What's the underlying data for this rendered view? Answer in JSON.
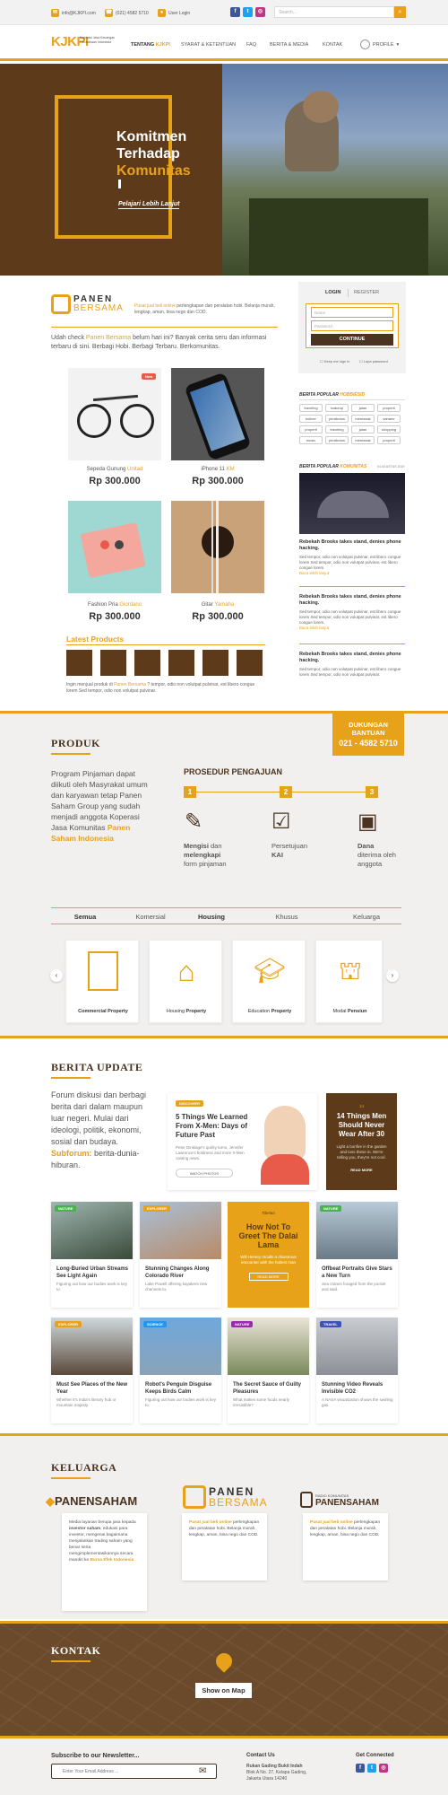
{
  "topbar": {
    "email": "info@KJKPI.com",
    "phone": "(021) 4582 5710",
    "login": "User Login",
    "search_placeholder": "Search..."
  },
  "brand": {
    "logo": "KJKPI",
    "tagline": "Koperasi Jasa Keuangan Perusahaan Indonesia"
  },
  "nav": {
    "items": [
      {
        "pre": "TENTANG ",
        "em": "KJKPI"
      },
      {
        "pre": "SYARAT & KETENTUAN",
        "em": ""
      },
      {
        "pre": "FAQ",
        "em": ""
      },
      {
        "pre": "BERITA & MEDIA",
        "em": ""
      },
      {
        "pre": "KONTAK",
        "em": ""
      }
    ],
    "profile": "PROFILE"
  },
  "hero": {
    "line1": "Komitmen",
    "line2": "Terhadap",
    "line3": "Komunitas",
    "cta": "Pelajari Lebih Lanjut"
  },
  "panen": {
    "logo_top": "PANEN",
    "logo_bottom": "BERSAMA",
    "tagline_em": "Pusat jual beli online",
    "tagline": " perlengkapan dan peralatan hobi. Belanja murah, lengkap, aman, bisa nego dan COD.",
    "intro_pre": "Udah check ",
    "intro_em": "Panen Bersama",
    "intro_post": " belum hari ini? Banyak cerita seru dan informasi terbaru di sini. Berbagi Hobi. Berbagi Terbaru. Berkomunitas.",
    "products": [
      {
        "name": "Sepeda Gunung ",
        "em": "Unitad",
        "price": "Rp 300.000",
        "badge": "New"
      },
      {
        "name": "iPhone 11 ",
        "em": "KM",
        "price": "Rp 300.000",
        "badge": ""
      },
      {
        "name": "Fashion Pria ",
        "em": "Giordano",
        "price": "Rp 300.000",
        "badge": ""
      },
      {
        "name": "Gitar ",
        "em": "Yamaha",
        "price": "Rp 300.000",
        "badge": ""
      }
    ],
    "latest_title": "Latest Products",
    "latest_text_pre": "Ingin menjual produk di ",
    "latest_text_em": "Panen Bersama",
    "latest_text_post": " ? tempor, odio non volutpat pulvinar, est libero congue lorem Sed tempor, odio non volutpat pulvinar."
  },
  "login": {
    "tab_login": "LOGIN",
    "tab_register": "REGISTER",
    "name_ph": "Name",
    "pass_ph": "Password",
    "button": "CONTINUE",
    "keep": "Keep me sign in",
    "forgot": "Lupa password"
  },
  "sidebar": {
    "popular_title": "BERITA POPULAR",
    "popular_em": "HOBBIESID",
    "tags": [
      "traveling",
      "makeup",
      "jalan",
      "properti",
      "kuliner",
      "perabotan",
      "memasak",
      "sahamr",
      "properti",
      "traveling",
      "jalan",
      "shopping",
      "music",
      "perabotan",
      "memasak",
      "properti"
    ],
    "popular2_title": "BERITA POPULAR",
    "popular2_em": "KOMUNITAS",
    "date": "04 AGUSTUS 2019",
    "news": [
      {
        "title": "Rebekah Brooks takes stand, denies phone hacking.",
        "text": "Sed tempor, odio non volutpat pulvinar, est libero congue lorem Sed tempor, odio non volutpat pulvinar, est libero congue lorem.",
        "more": "Baca lebih lanjut"
      },
      {
        "title": "Rebekah Brooks takes stand, denies phone hacking.",
        "text": "Sed tempor, odio non volutpat pulvinar, est libero congue lorem Sed tempor, odio non volutpat pulvinar, est libero congue lorem.",
        "more": "Baca lebih lanjut"
      },
      {
        "title": "Rebekah Brooks takes stand, denies phone hacking.",
        "text": "Sed tempor, odio non volutpat pulvinar, est libero congue lorem Sed tempor, odio non volutpat pulvinar.",
        "more": ""
      }
    ]
  },
  "produk": {
    "title": "PRODUK",
    "dukungan1": "DUKUNGAN",
    "dukungan2": "BANTUAN",
    "phone": "021 - 4582 5710",
    "desc": "Program Pinjaman dapat diikuti oleh Masyrakat umum dan karyawan tetap Panen Saham Group yang sudah menjadi anggota Koperasi Jasa Komunitas ",
    "desc_em": "Panen Saham Indonesia",
    "prosedur_title": "PROSEDUR PENGAJUAN",
    "steps": [
      {
        "num": "1",
        "bold": "Mengisi",
        "pre": "",
        "post": " dan",
        "line2b": "melengkapi",
        "line3": "form pinjaman"
      },
      {
        "num": "2",
        "bold": "",
        "pre": "Persetujuan",
        "post": "",
        "line2b": "KAI",
        "line3": ""
      },
      {
        "num": "3",
        "bold": "Dana",
        "pre": "",
        "post": "",
        "line2b": "",
        "line3": "diterima oleh anggota"
      }
    ],
    "tabs": [
      "Semua",
      "Komersial",
      "Housing",
      "Khusus",
      "Keluarga"
    ],
    "cards": [
      {
        "bold": "Commercial Property",
        "pre": ""
      },
      {
        "bold": "Property",
        "pre": "Housing "
      },
      {
        "bold": "Property",
        "pre": "Education "
      },
      {
        "bold": "Pensiun",
        "pre": "Modal "
      }
    ]
  },
  "berita": {
    "title": "BERITA UPDATE",
    "desc": "Forum diskusi dan berbagi berita dari dalam maupun luar negeri. Mulai dari ideologi, politik, ekonomi, sosial dan budaya. ",
    "desc_em": "Subforum:",
    "desc_post": " berita-dunia-hiburan.",
    "feature": {
      "tag": "DISCOVERY",
      "title": "5 Things We Learned From X-Men: Days of Future Past",
      "text": "Peter Dinklage's quirky turns, Jennifer Lawrence's boldness and more X-Men casting news.",
      "button": "WATCH PHOTOS"
    },
    "feature2": {
      "num": "14",
      "title": "14 Things Men Should Never Wear After 30",
      "text": "Light a bonfire in the garden and toss these in. We're telling you, they're not cool.",
      "more": "READ MORE"
    },
    "row1": [
      {
        "tag": "NATURE",
        "title": "Long-Buried Urban Streams See Light Again",
        "text": "Figuring out how our bodies work is key to."
      },
      {
        "tag": "EXPLORER",
        "title": "Stunning Changes Along Colorado River",
        "text": "Lake Powell offering kayakers new channels to."
      },
      {
        "tag": "",
        "title": "How Not To Greet The Dalai Lama",
        "text": "Will Hersey recalls a disastrous encounter with the holiest man",
        "more": "READ MORE",
        "kicker": "Tibetan"
      },
      {
        "tag": "NATURE",
        "title": "Offbeat Portraits Give Stars a New Turn",
        "text": "Sea cranes foraged from the pocket and said."
      }
    ],
    "row2": [
      {
        "tag": "EXPLORER",
        "title": "Must See Places of the New Year",
        "text": "Whether it's India's literary hub or mountain majesty."
      },
      {
        "tag": "SCIENCE",
        "title": "Robot's Penguin Disguise Keeps Birds Calm",
        "text": "Figuring out how our bodies work is key to."
      },
      {
        "tag": "NATURE",
        "title": "The Secret Sauce of Guilty Pleasures",
        "text": "What makes some foods nearly irresistible?"
      },
      {
        "tag": "TRAVEL",
        "title": "Stunning Video Reveals Invisible CO2",
        "text": "A NASA visualization shows the swirling gas."
      }
    ]
  },
  "keluarga": {
    "title": "KELUARGA",
    "items": [
      {
        "logo": "PANENSAHAM",
        "text_pre": "Media layanan berupa jasa kepada ",
        "text_b": "investor saham",
        "text_post": ", edukasi para investor, mengenai bagaimana menjalankan trading saham yang benar serta mengimplementasikannya secara mandiri ke ",
        "text_em": "Bursa Efek Indonesia"
      },
      {
        "logo_top": "PANEN",
        "logo_bottom": "BERSAMA",
        "em": "Pusat jual beli online",
        "text": " perlengkapan dan peralatan hobi. Belanja murah, lengkap, aman, bisa nego dan COD."
      },
      {
        "logo_top": "RADIO KOMUNITAS",
        "logo_bottom": "PANENSAHAM",
        "em": "Pusat jual beli online",
        "text": " perlengkapan dan peralatan hobi. Belanja murah, lengkap, aman, bisa nego dan COD."
      }
    ]
  },
  "kontak": {
    "title": "KONTAK",
    "map_button": "Show on Map"
  },
  "footer": {
    "newsletter": "Subscribe to our Newsletter...",
    "email_ph": "Enter Your Email Address ...",
    "contact_title": "Contact Us",
    "addr1": "Rukan Gading Bukit Indah",
    "addr2": "Blok A No. 27, Kelapa Gading,",
    "addr3": "Jakarta Utara 14240",
    "social_title": "Get Connected"
  },
  "colors": {
    "accent": "#e8a21a",
    "brown": "#5c3a1a",
    "light": "#f2f0ee"
  }
}
